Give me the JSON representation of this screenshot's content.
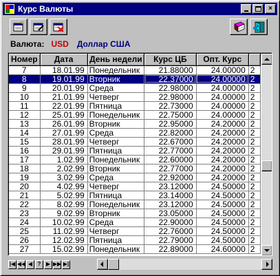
{
  "window": {
    "title": "Курс Валюты",
    "minimize_label": "_",
    "close_label": "×"
  },
  "toolbar": {
    "left_icons": [
      "add-record-icon",
      "edit-record-icon",
      "delete-record-icon"
    ],
    "right_icons": [
      "book-icon",
      "exit-door-icon"
    ]
  },
  "currency": {
    "label": "Валюта:",
    "code": "USD",
    "name": "Доллар США"
  },
  "table": {
    "columns": [
      "Номер",
      "Дата",
      "День недели",
      "Курс ЦБ",
      "Опт. Курс"
    ],
    "selected_row_index": 1,
    "rows": [
      {
        "num": "7",
        "date": "18.01.99",
        "day": "Понедельник",
        "cb": "21.88000",
        "opt": "24.00000",
        "extra": "2"
      },
      {
        "num": "8",
        "date": "19.01.99",
        "day": "Вторник",
        "cb": "22.37000",
        "opt": "24.00000",
        "extra": "2"
      },
      {
        "num": "9",
        "date": "20.01.99",
        "day": "Среда",
        "cb": "22.98000",
        "opt": "24.00000",
        "extra": "2"
      },
      {
        "num": "10",
        "date": "21.01.99",
        "day": "Четверг",
        "cb": "22.98000",
        "opt": "24.00000",
        "extra": "2"
      },
      {
        "num": "11",
        "date": "22.01.99",
        "day": "Пятница",
        "cb": "22.73000",
        "opt": "24.00000",
        "extra": "2"
      },
      {
        "num": "12",
        "date": "25.01.99",
        "day": "Понедельник",
        "cb": "22.75000",
        "opt": "24.00000",
        "extra": "2"
      },
      {
        "num": "13",
        "date": "26.01.99",
        "day": "Вторник",
        "cb": "22.95000",
        "opt": "24.20000",
        "extra": "2"
      },
      {
        "num": "14",
        "date": "27.01.99",
        "day": "Среда",
        "cb": "22.82000",
        "opt": "24.20000",
        "extra": "2"
      },
      {
        "num": "15",
        "date": "28.01.99",
        "day": "Четверг",
        "cb": "22.67000",
        "opt": "24.20000",
        "extra": "2"
      },
      {
        "num": "16",
        "date": "29.01.99",
        "day": "Пятница",
        "cb": "22.77000",
        "opt": "24.20000",
        "extra": "2"
      },
      {
        "num": "17",
        "date": "1.02.99",
        "day": "Понедельник",
        "cb": "22.60000",
        "opt": "24.20000",
        "extra": "2"
      },
      {
        "num": "18",
        "date": "2.02.99",
        "day": "Вторник",
        "cb": "22.77000",
        "opt": "24.20000",
        "extra": "2"
      },
      {
        "num": "19",
        "date": "3.02.99",
        "day": "Среда",
        "cb": "22.92000",
        "opt": "24.20000",
        "extra": "2"
      },
      {
        "num": "20",
        "date": "4.02.99",
        "day": "Четверг",
        "cb": "23.12000",
        "opt": "24.50000",
        "extra": "2"
      },
      {
        "num": "21",
        "date": "5.02.99",
        "day": "Пятница",
        "cb": "23.14000",
        "opt": "24.50000",
        "extra": "2"
      },
      {
        "num": "22",
        "date": "8.02.99",
        "day": "Понедельник",
        "cb": "23.12000",
        "opt": "24.50000",
        "extra": "2"
      },
      {
        "num": "23",
        "date": "9.02.99",
        "day": "Вторник",
        "cb": "23.05000",
        "opt": "24.50000",
        "extra": "2"
      },
      {
        "num": "24",
        "date": "10.02.99",
        "day": "Среда",
        "cb": "22.90000",
        "opt": "24.50000",
        "extra": "2"
      },
      {
        "num": "25",
        "date": "11.02.99",
        "day": "Четверг",
        "cb": "22.76000",
        "opt": "24.50000",
        "extra": "2"
      },
      {
        "num": "26",
        "date": "12.02.99",
        "day": "Пятница",
        "cb": "22.79000",
        "opt": "24.50000",
        "extra": "2"
      },
      {
        "num": "27",
        "date": "15.02.99",
        "day": "Понедельник",
        "cb": "22.89000",
        "opt": "24.60000",
        "extra": "2"
      }
    ]
  },
  "navigator": {
    "buttons": [
      "|◀",
      "◀◀",
      "◀",
      "?",
      "▶",
      "▶▶",
      "▶|"
    ]
  },
  "colors": {
    "title_bar": "#000080",
    "selection": "#000080",
    "currency_code": "#c00000",
    "currency_name": "#000080"
  }
}
